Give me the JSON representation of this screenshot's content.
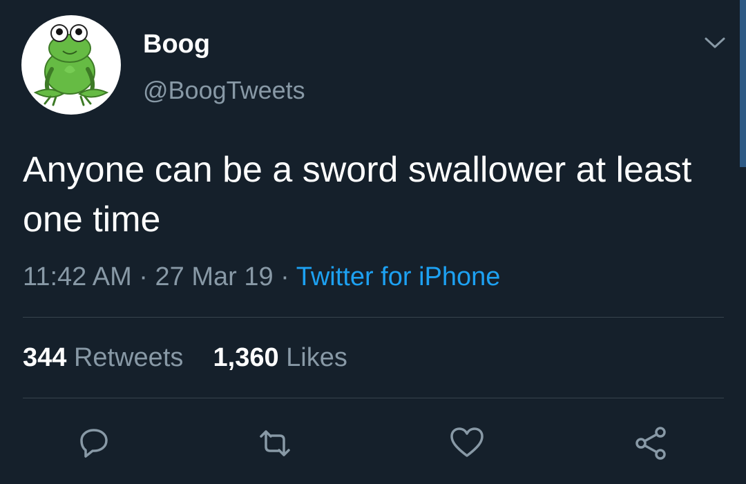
{
  "tweet": {
    "display_name": "Boog",
    "handle": "@BoogTweets",
    "text": "Anyone can be a sword swallower at least one time",
    "time": "11:42 AM",
    "date": "27 Mar 19",
    "source": "Twitter for iPhone",
    "separator": "·"
  },
  "stats": {
    "retweets_count": "344",
    "retweets_label": "Retweets",
    "likes_count": "1,360",
    "likes_label": "Likes"
  },
  "icons": {
    "avatar": "frog-avatar",
    "menu": "chevron-down-icon",
    "reply": "reply-icon",
    "retweet": "retweet-icon",
    "like": "heart-icon",
    "share": "share-icon"
  },
  "colors": {
    "background": "#15202b",
    "primary_text": "#ffffff",
    "secondary_text": "#8899a6",
    "link": "#1da1f2",
    "divider": "#38444d"
  }
}
